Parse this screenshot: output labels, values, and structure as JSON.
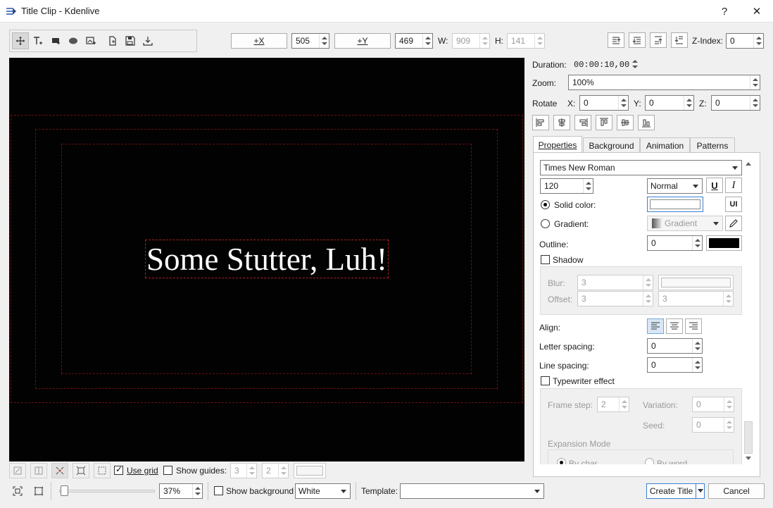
{
  "window": {
    "title": "Title Clip - Kdenlive",
    "help": "?",
    "close": "✕"
  },
  "toolbar": {
    "x_button": "+X",
    "x_value": "505",
    "y_button": "+Y",
    "y_value": "469",
    "w_label": "W:",
    "w_value": "909",
    "h_label": "H:",
    "h_value": "141",
    "zindex_label": "Z-Index:",
    "zindex_value": "0"
  },
  "canvas": {
    "text": "Some Stutter, Luh!",
    "background": "#020202"
  },
  "right": {
    "duration_label": "Duration:",
    "duration_value": "00:00:10,00",
    "zoom_label": "Zoom:",
    "zoom_value": "100%",
    "rotate_label": "Rotate",
    "rx_label": "X:",
    "rx_value": "0",
    "ry_label": "Y:",
    "ry_value": "0",
    "rz_label": "Z:",
    "rz_value": "0"
  },
  "tabs": [
    "Properties",
    "Background",
    "Animation",
    "Patterns"
  ],
  "props": {
    "font": "Times New Roman",
    "size": "120",
    "weight": "Normal",
    "solid_label": "Solid color:",
    "gradient_label": "Gradient:",
    "gradient_value": "Gradient",
    "outline_label": "Outline:",
    "outline_value": "0",
    "shadow_label": "Shadow",
    "blur_label": "Blur:",
    "blur_value": "3",
    "offset_label": "Offset:",
    "offset_x": "3",
    "offset_y": "3",
    "align_label": "Align:",
    "letter_label": "Letter spacing:",
    "letter_value": "0",
    "line_label": "Line spacing:",
    "line_value": "0",
    "typewriter_label": "Typewriter effect",
    "frame_label": "Frame step:",
    "frame_value": "2",
    "variation_label": "Variation:",
    "variation_value": "0",
    "seed_label": "Seed:",
    "seed_value": "0",
    "expansion_label": "Expansion Mode",
    "bychar_label": "By char",
    "byword_label": "By word",
    "outline_color": "#000000"
  },
  "bottom": {
    "use_grid": "Use grid",
    "show_guides": "Show guides:",
    "guides_a": "3",
    "guides_b": "2",
    "zoom_value": "37%",
    "show_background": "Show background",
    "bg_color": "White",
    "template_label": "Template:",
    "create_title": "Create Title",
    "cancel": "Cancel"
  }
}
